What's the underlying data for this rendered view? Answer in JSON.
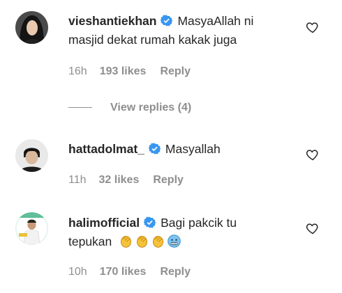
{
  "comments": [
    {
      "username": "vieshantiekhan",
      "text_line1": "MasyaAllah ni",
      "text_line2": "masjid dekat rumah kakak juga",
      "time": "16h",
      "likes": "193 likes",
      "reply": "Reply"
    },
    {
      "username": "hattadolmat_",
      "text": "Masyallah",
      "time": "11h",
      "likes": "32 likes",
      "reply": "Reply"
    },
    {
      "username": "halimofficial",
      "text_line1": "Bagi pakcik tu",
      "text_line2": "tepukan",
      "emojis": [
        "clapping-hands",
        "clapping-hands",
        "clapping-hands",
        "cold-face"
      ],
      "time": "10h",
      "likes": "170 likes",
      "reply": "Reply"
    }
  ],
  "view_replies": "View replies (4)",
  "colors": {
    "verified": "#3897f0",
    "muted": "#8e8e8e",
    "text": "#262626"
  }
}
